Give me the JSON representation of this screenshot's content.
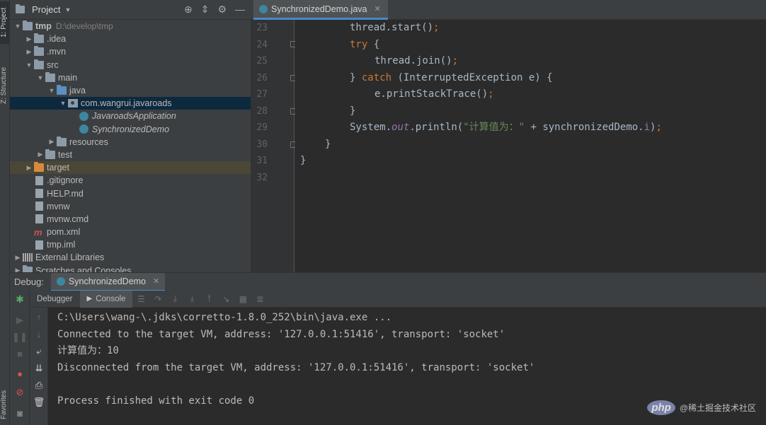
{
  "left_strip": {
    "project_tab": "1: Project",
    "structure_tab": "Z: Structure",
    "favorites_tab": "Favorites"
  },
  "project_panel": {
    "title": "Project",
    "tree": [
      {
        "label": "tmp",
        "extra": "D:\\develop\\tmp",
        "indent": 0,
        "arrow": "down",
        "icon": "folder"
      },
      {
        "label": ".idea",
        "indent": 1,
        "arrow": "right",
        "icon": "folder"
      },
      {
        "label": ".mvn",
        "indent": 1,
        "arrow": "right",
        "icon": "folder"
      },
      {
        "label": "src",
        "indent": 1,
        "arrow": "down",
        "icon": "folder"
      },
      {
        "label": "main",
        "indent": 2,
        "arrow": "down",
        "icon": "folder"
      },
      {
        "label": "java",
        "indent": 3,
        "arrow": "down",
        "icon": "folder-blue"
      },
      {
        "label": "com.wangrui.javaroads",
        "indent": 4,
        "arrow": "down",
        "icon": "package",
        "selected": true
      },
      {
        "label": "JavaroadsApplication",
        "indent": 5,
        "arrow": "",
        "icon": "class"
      },
      {
        "label": "SynchronizedDemo",
        "indent": 5,
        "arrow": "",
        "icon": "class"
      },
      {
        "label": "resources",
        "indent": 3,
        "arrow": "right",
        "icon": "folder"
      },
      {
        "label": "test",
        "indent": 2,
        "arrow": "right",
        "icon": "folder"
      },
      {
        "label": "target",
        "indent": 1,
        "arrow": "right",
        "icon": "folder-orange",
        "highlight": true
      },
      {
        "label": ".gitignore",
        "indent": 1,
        "arrow": "",
        "icon": "file"
      },
      {
        "label": "HELP.md",
        "indent": 1,
        "arrow": "",
        "icon": "file"
      },
      {
        "label": "mvnw",
        "indent": 1,
        "arrow": "",
        "icon": "file"
      },
      {
        "label": "mvnw.cmd",
        "indent": 1,
        "arrow": "",
        "icon": "file"
      },
      {
        "label": "pom.xml",
        "indent": 1,
        "arrow": "",
        "icon": "maven"
      },
      {
        "label": "tmp.iml",
        "indent": 1,
        "arrow": "",
        "icon": "file"
      },
      {
        "label": "External Libraries",
        "indent": 0,
        "arrow": "right",
        "icon": "library"
      },
      {
        "label": "Scratches and Consoles",
        "indent": 0,
        "arrow": "right",
        "icon": "folder"
      }
    ]
  },
  "editor": {
    "tab_label": "SynchronizedDemo.java",
    "line_numbers": [
      "23",
      "24",
      "25",
      "26",
      "27",
      "28",
      "29",
      "30",
      "31",
      "32"
    ],
    "lines": {
      "l23": {
        "a": "thread.start()",
        "b": ";"
      },
      "l24": {
        "a": "try",
        "b": " {"
      },
      "l25": {
        "a": "thread.join()",
        "b": ";"
      },
      "l26": {
        "a": "} ",
        "b": "catch",
        "c": " (InterruptedException e) {"
      },
      "l27": {
        "a": "e.printStackTrace()",
        "b": ";"
      },
      "l28": {
        "a": "}"
      },
      "l29": {
        "a": "System.",
        "b": "out",
        "c": ".println(",
        "d": "\"计算值为：\"",
        "e": " + synchronizedDemo.",
        "f": "i",
        "g": ")",
        "h": ";"
      },
      "l30": {
        "a": "}"
      },
      "l31": {
        "a": "}"
      }
    }
  },
  "debug": {
    "label": "Debug:",
    "tab_label": "SynchronizedDemo",
    "debugger_label": "Debugger",
    "console_label": "Console",
    "console_lines": [
      "C:\\Users\\wang-\\.jdks\\corretto-1.8.0_252\\bin\\java.exe ...",
      "Connected to the target VM, address: '127.0.0.1:51416', transport: 'socket'",
      "计算值为：10",
      "Disconnected from the target VM, address: '127.0.0.1:51416', transport: 'socket'",
      "",
      "Process finished with exit code 0"
    ]
  },
  "watermark": {
    "logo_text": "php",
    "text": "@稀土掘金技术社区"
  }
}
